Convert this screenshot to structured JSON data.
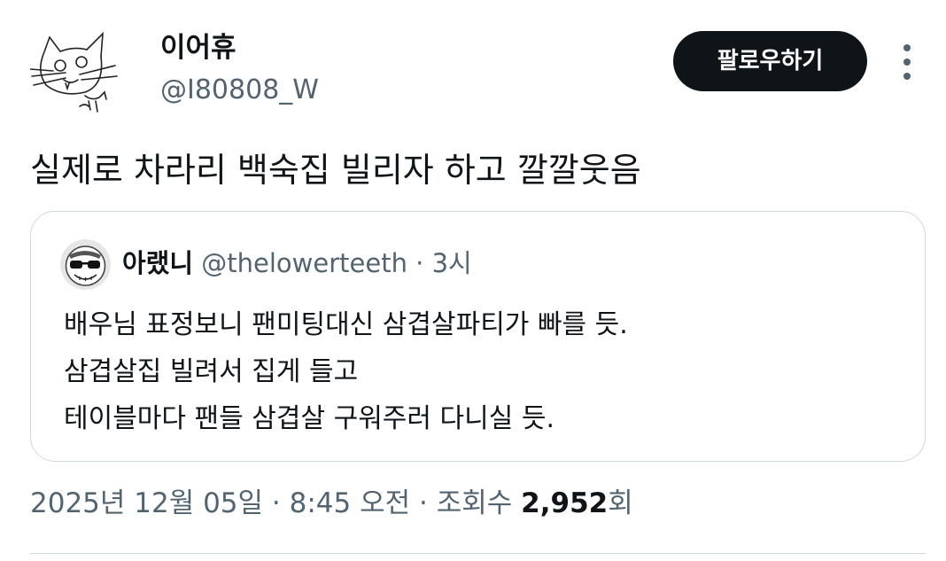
{
  "author": {
    "display_name": "이어휴",
    "handle": "@I80808_W",
    "avatar_icon": "cat-doodle-avatar-icon"
  },
  "actions": {
    "follow_label": "팔로우하기",
    "more_icon": "more-vertical-icon"
  },
  "tweet": {
    "text": "실제로 차라리 백숙집 빌리자 하고 깔깔웃음"
  },
  "quote": {
    "display_name": "아랬니",
    "handle": "@thelowerteeth",
    "separator": "·",
    "time": "3시",
    "avatar_icon": "sunglasses-face-avatar-icon",
    "lines": [
      "배우님 표정보니 팬미팅대신 삼겹살파티가 빠를 듯.",
      "삼겹살집 빌려서 집게 들고",
      "테이블마다 팬들 삼겹살 구워주러 다니실 듯."
    ]
  },
  "meta": {
    "date": "2025년 12월 05일",
    "separator": "·",
    "time": "8:45 오전",
    "views_label": "조회수",
    "views_count": "2,952",
    "views_suffix": "회"
  },
  "colors": {
    "text_primary": "#0f1419",
    "text_secondary": "#536471",
    "border": "#cfd9de",
    "button_bg": "#0f1419",
    "button_text": "#ffffff"
  }
}
